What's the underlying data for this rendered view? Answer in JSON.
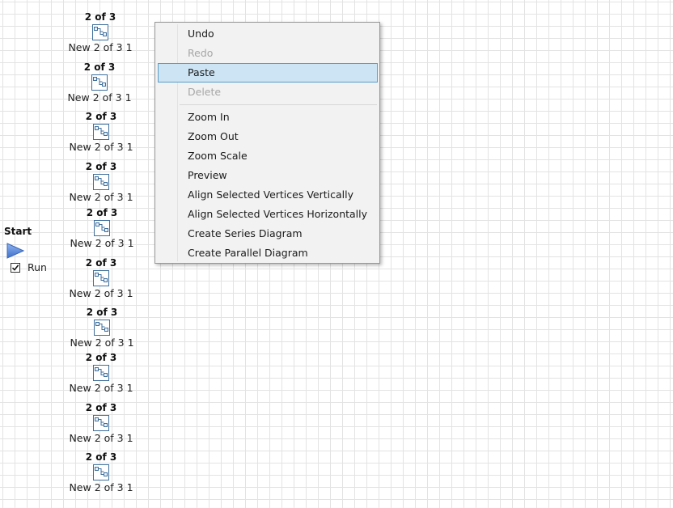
{
  "canvas": {
    "nodes": [
      {
        "title": "2 of 3",
        "label": "New 2 of 3 1"
      },
      {
        "title": "2 of 3",
        "label": "New 2 of 3 1"
      },
      {
        "title": "2 of 3",
        "label": "New 2 of 3 1"
      },
      {
        "title": "2 of 3",
        "label": "New 2 of 3 1"
      },
      {
        "title": "2 of 3",
        "label": "New 2 of 3 1"
      },
      {
        "title": "2 of 3",
        "label": "New 2 of 3 1"
      },
      {
        "title": "2 of 3",
        "label": "New 2 of 3 1"
      },
      {
        "title": "2 of 3",
        "label": "New 2 of 3 1"
      },
      {
        "title": "2 of 3",
        "label": "New 2 of 3 1"
      },
      {
        "title": "2 of 3",
        "label": "New 2 of 3 1"
      }
    ],
    "start": {
      "title": "Start",
      "run_label": "Run",
      "run_checked": true,
      "icon": "play-triangle-icon"
    }
  },
  "context_menu": {
    "items": [
      {
        "label": "Undo",
        "enabled": true
      },
      {
        "label": "Redo",
        "enabled": false
      },
      {
        "label": "Paste",
        "enabled": true,
        "highlighted": true
      },
      {
        "label": "Delete",
        "enabled": false
      },
      {
        "label": "Zoom In",
        "enabled": true
      },
      {
        "label": "Zoom Out",
        "enabled": true
      },
      {
        "label": "Zoom Scale",
        "enabled": true
      },
      {
        "label": "Preview",
        "enabled": true
      },
      {
        "label": "Align Selected Vertices Vertically",
        "enabled": true
      },
      {
        "label": "Align Selected Vertices Horizontally",
        "enabled": true
      },
      {
        "label": "Create Series Diagram",
        "enabled": true
      },
      {
        "label": "Create Parallel Diagram",
        "enabled": true
      }
    ]
  },
  "colors": {
    "accent_highlight": "#cce4f4",
    "highlight_border": "#5c9ec9",
    "disabled_text": "#a6a6a6",
    "start_triangle": "#4a7fd4"
  }
}
